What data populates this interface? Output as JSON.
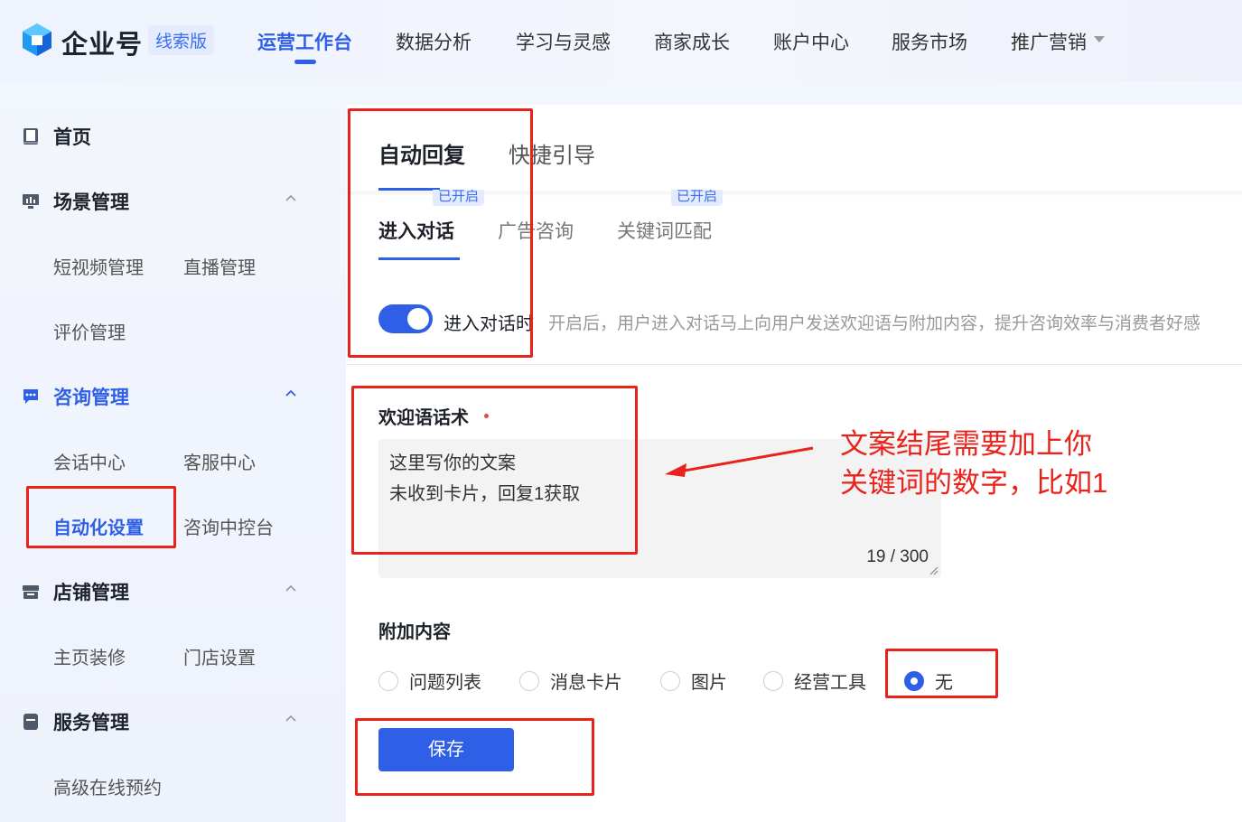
{
  "header": {
    "brand": "企业号",
    "edition": "线索版",
    "nav": [
      {
        "label": "运营工作台",
        "active": true
      },
      {
        "label": "数据分析"
      },
      {
        "label": "学习与灵感"
      },
      {
        "label": "商家成长"
      },
      {
        "label": "账户中心"
      },
      {
        "label": "服务市场"
      },
      {
        "label": "推广营销",
        "has_dropdown": true
      }
    ]
  },
  "sidebar": {
    "home": "首页",
    "scene": {
      "label": "场景管理",
      "items": [
        "短视频管理",
        "直播管理",
        "评价管理"
      ]
    },
    "consult": {
      "label": "咨询管理",
      "items": [
        "会话中心",
        "客服中心",
        "自动化设置",
        "咨询中控台"
      ],
      "active_item": "自动化设置"
    },
    "store": {
      "label": "店铺管理",
      "items": [
        "主页装修",
        "门店设置"
      ]
    },
    "service": {
      "label": "服务管理",
      "items": [
        "高级在线预约"
      ]
    }
  },
  "main": {
    "tabs": [
      "自动回复",
      "快捷引导"
    ],
    "active_tab": "自动回复",
    "sub_tabs": [
      {
        "label": "进入对话",
        "active": true
      },
      {
        "label": "广告咨询",
        "badge": "已开启"
      },
      {
        "label": "关键词匹配",
        "badge": "已开启"
      }
    ],
    "toggle": {
      "label": "进入对话时",
      "on": true,
      "description": "开启后，用户进入对话马上向用户发送欢迎语与附加内容，提升咨询效率与消费者好感"
    },
    "welcome": {
      "label": "欢迎语话术",
      "lines": [
        "这里写你的文案",
        "未收到卡片，回复1获取"
      ],
      "counter": "19 / 300"
    },
    "attachment": {
      "label": "附加内容",
      "options": [
        "问题列表",
        "消息卡片",
        "图片",
        "经营工具",
        "无"
      ],
      "selected": "无"
    },
    "save_label": "保存"
  },
  "annotation": {
    "lines": [
      "文案结尾需要加上你",
      "关键词的数字，比如1"
    ],
    "color": "#e8231c"
  },
  "colors": {
    "accent": "#2f5fe6",
    "annotation": "#e8231c"
  }
}
